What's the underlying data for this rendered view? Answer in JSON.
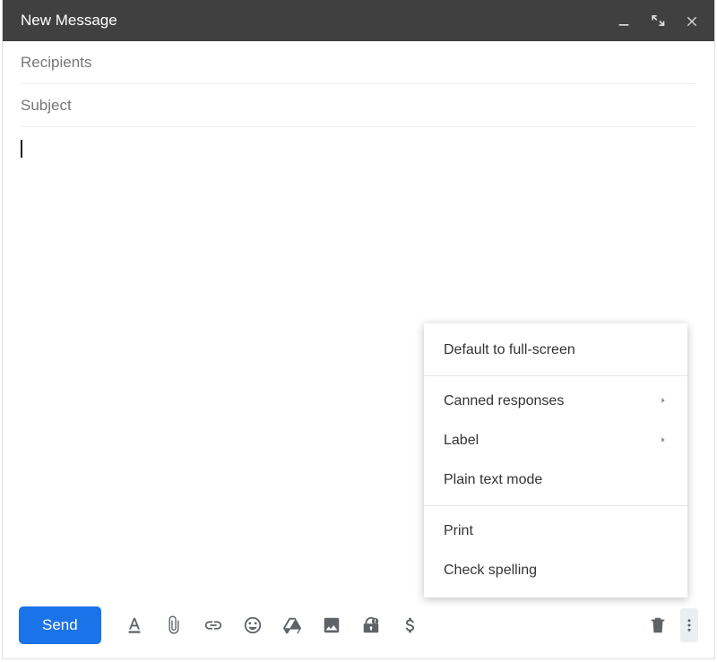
{
  "header": {
    "title": "New Message"
  },
  "fields": {
    "recipients_label": "Recipients",
    "subject_label": "Subject"
  },
  "toolbar": {
    "send_label": "Send"
  },
  "menu": {
    "default_fullscreen": "Default to full-screen",
    "canned_responses": "Canned responses",
    "label": "Label",
    "plain_text": "Plain text mode",
    "print": "Print",
    "check_spelling": "Check spelling"
  }
}
